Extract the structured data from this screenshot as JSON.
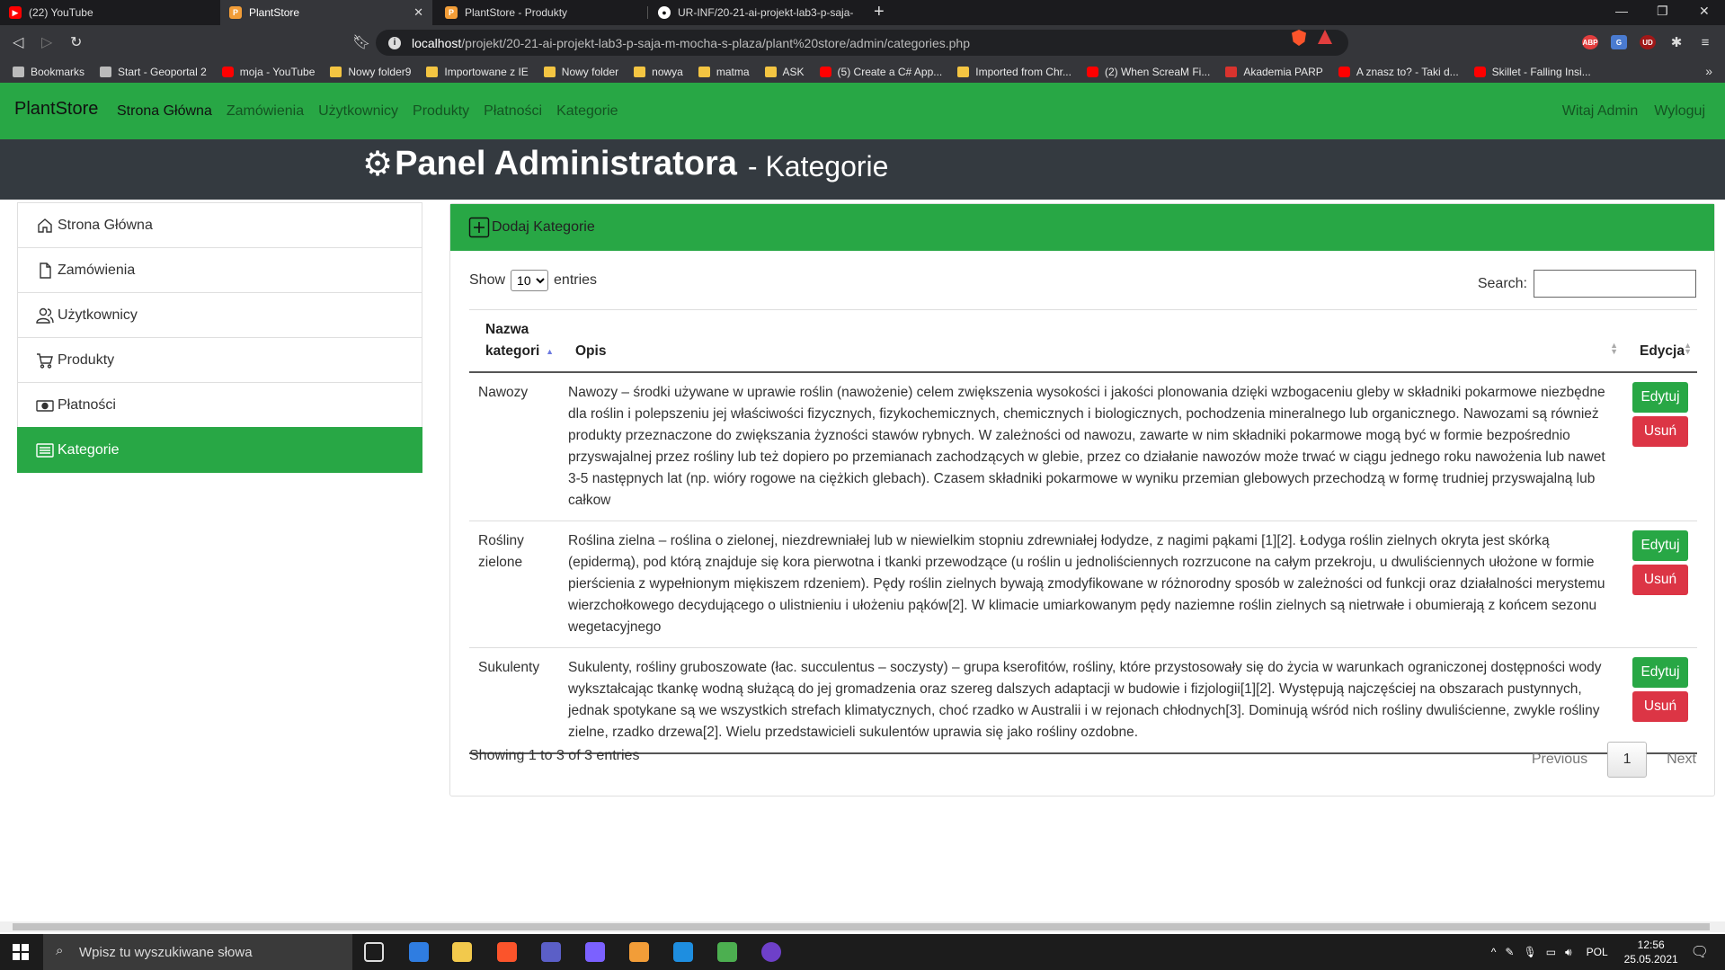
{
  "browser": {
    "tabs": [
      {
        "label": "(22) YouTube",
        "favicon": "youtube-icon",
        "color": "#ff0000"
      },
      {
        "label": "PlantStore",
        "favicon": "plantstore-icon",
        "color": "#f29d38"
      },
      {
        "label": "PlantStore - Produkty",
        "favicon": "plantstore-icon",
        "color": "#f29d38"
      },
      {
        "label": "UR-INF/20-21-ai-projekt-lab3-p-saja-",
        "favicon": "github-icon",
        "color": "#ffffff"
      }
    ],
    "url_host": "localhost",
    "url_path": "/projekt/20-21-ai-projekt-lab3-p-saja-m-mocha-s-plaza/plant%20store/admin/categories.php",
    "bookmarks": [
      {
        "label": "Bookmarks",
        "icon": "bookmarks-icon"
      },
      {
        "label": "Start - Geoportal 2",
        "icon": "page-icon"
      },
      {
        "label": "moja - YouTube",
        "icon": "youtube-icon"
      },
      {
        "label": "Nowy folder9",
        "icon": "folder-icon"
      },
      {
        "label": "Importowane z IE",
        "icon": "folder-icon"
      },
      {
        "label": "Nowy folder",
        "icon": "folder-icon"
      },
      {
        "label": "nowya",
        "icon": "folder-icon"
      },
      {
        "label": "matma",
        "icon": "folder-icon"
      },
      {
        "label": "ASK",
        "icon": "folder-icon"
      },
      {
        "label": "(5) Create a C# App...",
        "icon": "youtube-icon"
      },
      {
        "label": "Imported from Chr...",
        "icon": "folder-icon"
      },
      {
        "label": "(2) When ScreaM Fi...",
        "icon": "youtube-icon"
      },
      {
        "label": "Akademia PARP",
        "icon": "parp-icon"
      },
      {
        "label": "A znasz to? - Taki d...",
        "icon": "youtube-icon"
      },
      {
        "label": "Skillet - Falling Insi...",
        "icon": "youtube-icon"
      }
    ],
    "extensions": [
      "ABP",
      "UD"
    ]
  },
  "site": {
    "brand": "PlantStore",
    "nav": [
      "Strona Główna",
      "Zamówienia",
      "Użytkownicy",
      "Produkty",
      "Płatności",
      "Kategorie"
    ],
    "greeting": "Witaj Admin",
    "logout": "Wyloguj",
    "panel_title": "Panel Administratora",
    "panel_subtitle": "- Kategorie"
  },
  "sidebar": [
    {
      "label": "Strona Główna",
      "icon": "home-icon"
    },
    {
      "label": "Zamówienia",
      "icon": "file-icon"
    },
    {
      "label": "Użytkownicy",
      "icon": "users-icon"
    },
    {
      "label": "Produkty",
      "icon": "cart-icon"
    },
    {
      "label": "Płatności",
      "icon": "cash-icon"
    },
    {
      "label": "Kategorie",
      "icon": "list-icon",
      "active": true
    }
  ],
  "card": {
    "add_label": "Dodaj Kategorie",
    "show_label": "Show",
    "entries_label": "entries",
    "page_size": "10",
    "search_label": "Search:",
    "search_value": "",
    "columns": [
      "Nazwa kategori",
      "Opis",
      "Edycja"
    ],
    "rows": [
      {
        "name": "Nawozy",
        "description": "Nawozy – środki używane w uprawie roślin (nawożenie) celem zwiększenia wysokości i jakości plonowania dzięki wzbogaceniu gleby w składniki pokarmowe niezbędne dla roślin i polepszeniu jej właściwości fizycznych, fizykochemicznych, chemicznych i biologicznych, pochodzenia mineralnego lub organicznego. Nawozami są również produkty przeznaczone do zwiększania żyzności stawów rybnych. W zależności od nawozu, zawarte w nim składniki pokarmowe mogą być w formie bezpośrednio przyswajalnej przez rośliny lub też dopiero po przemianach zachodzących w glebie, przez co działanie nawozów może trwać w ciągu jednego roku nawożenia lub nawet 3-5 następnych lat (np. wióry rogowe na ciężkich glebach). Czasem składniki pokarmowe w wyniku przemian glebowych przechodzą w formę trudniej przyswajalną lub całkow"
      },
      {
        "name": "Rośliny zielone",
        "description": "Roślina zielna – roślina o zielonej, niezdrewniałej lub w niewielkim stopniu zdrewniałej łodydze, z nagimi pąkami [1][2]. Łodyga roślin zielnych okryta jest skórką (epidermą), pod którą znajduje się kora pierwotna i tkanki przewodzące (u roślin u jednoliściennych rozrzucone na całym przekroju, u dwuliściennych ułożone w formie pierścienia z wypełnionym miękiszem rdzeniem). Pędy roślin zielnych bywają zmodyfikowane w różnorodny sposób w zależności od funkcji oraz działalności merystemu wierzchołkowego decydującego o ulistnieniu i ułożeniu pąków[2]. W klimacie umiarkowanym pędy naziemne roślin zielnych są nietrwałe i obumierają z końcem sezonu wegetacyjnego"
      },
      {
        "name": "Sukulenty",
        "description": "Sukulenty, rośliny gruboszowate (łac. succulentus – soczysty) – grupa kserofitów, rośliny, które przystosowały się do życia w warunkach ograniczonej dostępności wody wykształcając tkankę wodną służącą do jej gromadzenia oraz szereg dalszych adaptacji w budowie i fizjologii[1][2]. Występują najczęściej na obszarach pustynnych, jednak spotykane są we wszystkich strefach klimatycznych, choć rzadko w Australii i w rejonach chłodnych[3]. Dominują wśród nich rośliny dwuliścienne, zwykle rośliny zielne, rzadko drzewa[2]. Wielu przedstawicieli sukulentów uprawia się jako rośliny ozdobne."
      }
    ],
    "edit_label": "Edytuj",
    "delete_label": "Usuń",
    "info": "Showing 1 to 3 of 3 entries",
    "prev_label": "Previous",
    "page": "1",
    "next_label": "Next"
  },
  "taskbar": {
    "search_placeholder": "Wpisz tu wyszukiwane słowa",
    "lang": "POL",
    "time": "12:56",
    "date": "25.05.2021"
  },
  "colors": {
    "accent": "#28a745",
    "danger": "#dc3545",
    "hero": "#343a40"
  }
}
